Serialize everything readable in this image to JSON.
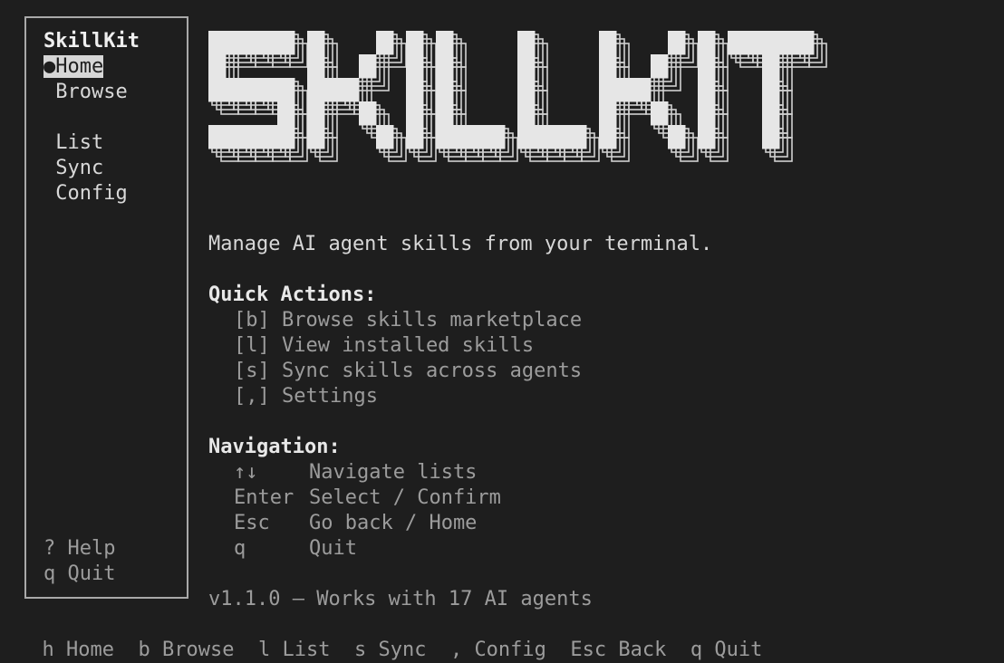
{
  "sidebar": {
    "brand": "SkillKit",
    "items": [
      {
        "bullet": "●",
        "label": "Home",
        "active": true
      },
      {
        "bullet": " ",
        "label": "Browse",
        "active": false
      },
      {
        "bullet": " ",
        "label": "List",
        "active": false
      },
      {
        "bullet": " ",
        "label": "Sync",
        "active": false
      },
      {
        "bullet": " ",
        "label": "Config",
        "active": false
      }
    ],
    "footer": [
      {
        "key": "?",
        "label": "Help"
      },
      {
        "key": "q",
        "label": "Quit"
      }
    ]
  },
  "logo_text": "SKILLKIT",
  "tagline": "Manage AI agent skills from your terminal.",
  "quick_actions": {
    "heading": "Quick Actions:",
    "items": [
      {
        "key": "[b]",
        "label": "Browse skills marketplace"
      },
      {
        "key": "[l]",
        "label": "View installed skills"
      },
      {
        "key": "[s]",
        "label": "Sync skills across agents"
      },
      {
        "key": "[,]",
        "label": "Settings"
      }
    ]
  },
  "navigation": {
    "heading": "Navigation:",
    "items": [
      {
        "key": "↑↓",
        "label": "Navigate lists"
      },
      {
        "key": "Enter",
        "label": "Select / Confirm"
      },
      {
        "key": "Esc",
        "label": "Go back / Home"
      },
      {
        "key": "q",
        "label": "Quit"
      }
    ]
  },
  "version_line": "v1.1.0 — Works with 17 AI agents",
  "statusbar": [
    {
      "key": "h",
      "label": "Home"
    },
    {
      "key": "b",
      "label": "Browse"
    },
    {
      "key": "l",
      "label": "List"
    },
    {
      "key": "s",
      "label": "Sync"
    },
    {
      "key": ",",
      "label": "Config"
    },
    {
      "key": "Esc",
      "label": "Back"
    },
    {
      "key": "q",
      "label": "Quit"
    }
  ],
  "colors": {
    "background": "#1e1e1e",
    "text": "#d8d8d8",
    "dim": "#9c9c9c",
    "border": "#a9a9a9"
  }
}
